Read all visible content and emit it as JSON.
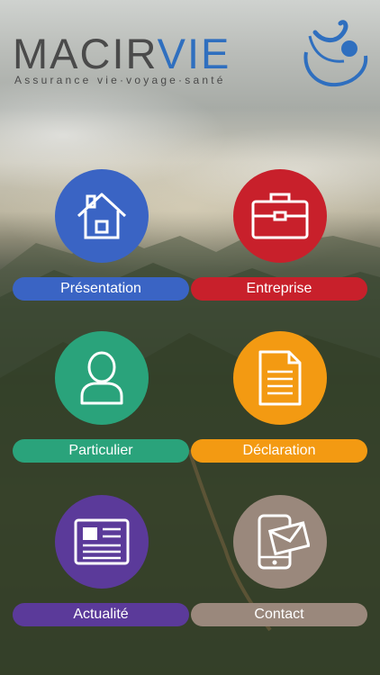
{
  "logo": {
    "word_part1": "MACIR",
    "word_part2": "VIE",
    "tagline": "Assurance vie·voyage·santé"
  },
  "colors": {
    "presentation": "#3a64c4",
    "entreprise": "#c8202b",
    "particulier": "#2aa37b",
    "declaration": "#f39a12",
    "actualite": "#5b3a9a",
    "contact": "#9a887c",
    "logo_blue": "#2f6fbf",
    "logo_gray": "#4a4a4a"
  },
  "menu": [
    {
      "id": "presentation",
      "label": "Présentation",
      "icon": "house-icon"
    },
    {
      "id": "entreprise",
      "label": "Entreprise",
      "icon": "briefcase-icon"
    },
    {
      "id": "particulier",
      "label": "Particulier",
      "icon": "person-icon"
    },
    {
      "id": "declaration",
      "label": "Déclaration",
      "icon": "document-icon"
    },
    {
      "id": "actualite",
      "label": "Actualité",
      "icon": "newspaper-icon"
    },
    {
      "id": "contact",
      "label": "Contact",
      "icon": "mail-phone-icon"
    }
  ]
}
